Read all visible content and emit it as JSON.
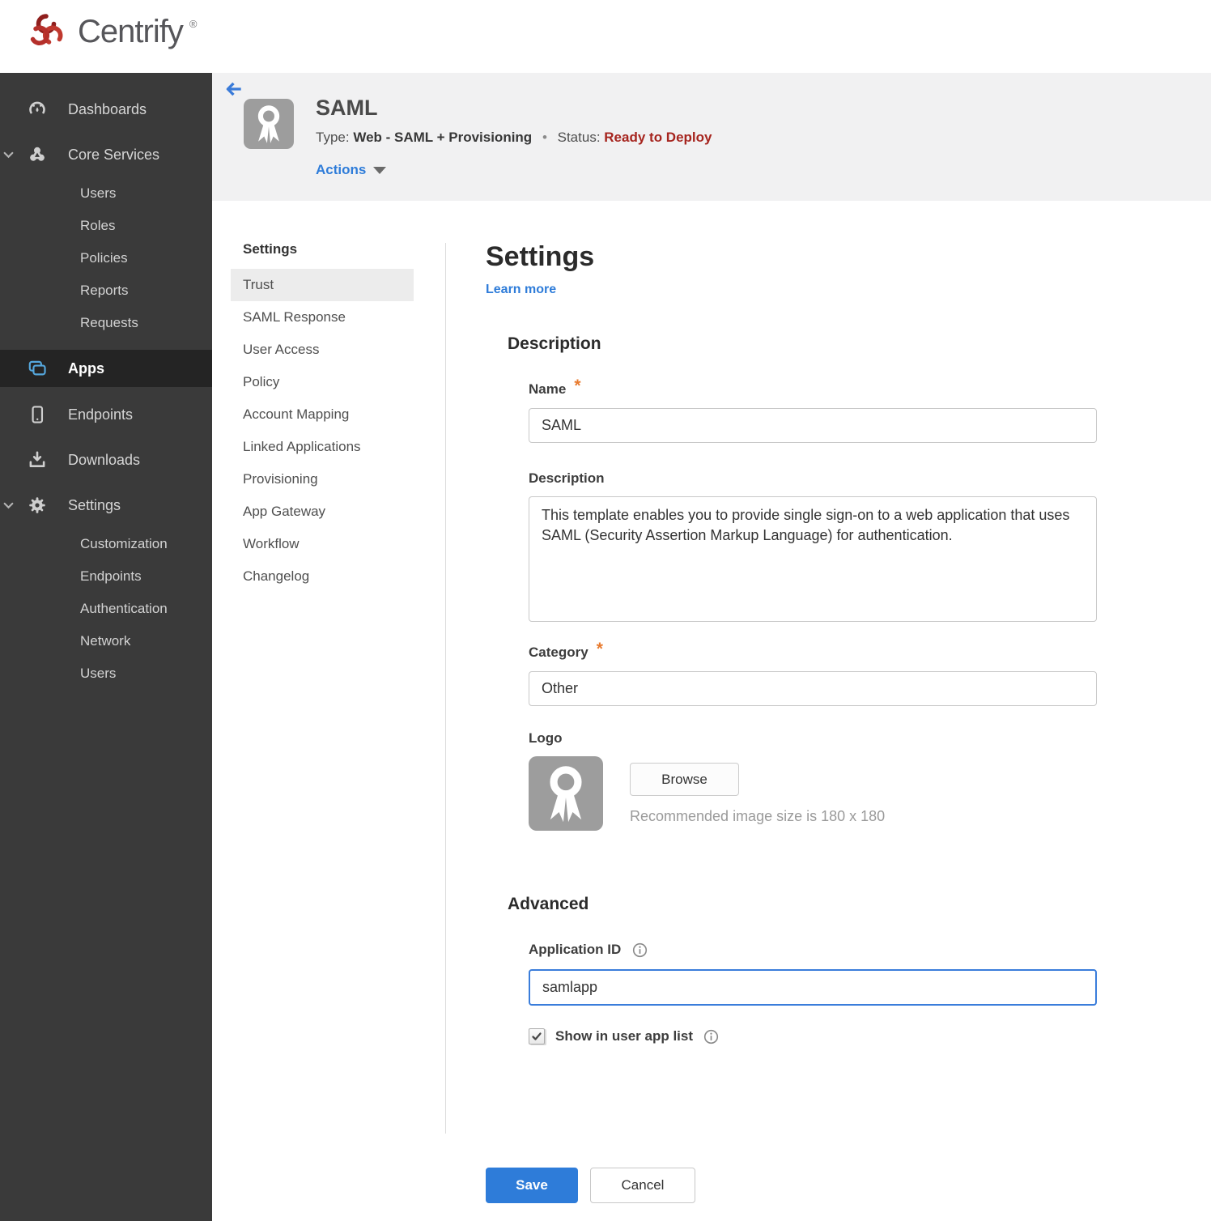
{
  "brand": {
    "name": "Centrify",
    "reg_mark": "®",
    "logo_color": "#b5302b"
  },
  "sidebar": {
    "items": [
      {
        "label": "Dashboards",
        "icon": "gauge-icon"
      },
      {
        "label": "Core Services",
        "icon": "core-services-icon",
        "expanded": true,
        "children": [
          "Users",
          "Roles",
          "Policies",
          "Reports",
          "Requests"
        ]
      },
      {
        "label": "Apps",
        "icon": "apps-icon",
        "active": true
      },
      {
        "label": "Endpoints",
        "icon": "device-icon"
      },
      {
        "label": "Downloads",
        "icon": "download-icon"
      },
      {
        "label": "Settings",
        "icon": "gear-icon",
        "expanded": true,
        "children": [
          "Customization",
          "Endpoints",
          "Authentication",
          "Network",
          "Users"
        ]
      }
    ]
  },
  "app_header": {
    "title": "SAML",
    "type_label": "Type:",
    "type_value": "Web - SAML + Provisioning",
    "separator": "•",
    "status_label": "Status:",
    "status_value": "Ready to Deploy",
    "status_color": "#a6251f",
    "actions_label": "Actions"
  },
  "subnav": {
    "header": "Settings",
    "active_item": "Trust",
    "items": [
      "Trust",
      "SAML Response",
      "User Access",
      "Policy",
      "Account Mapping",
      "Linked Applications",
      "Provisioning",
      "App Gateway",
      "Workflow",
      "Changelog"
    ]
  },
  "main": {
    "title": "Settings",
    "learn_more_label": "Learn more",
    "required_marker": "*",
    "sections": {
      "description": "Description",
      "advanced": "Advanced"
    },
    "fields": {
      "name_label": "Name",
      "name_value": "SAML",
      "description_label": "Description",
      "description_value": "This template enables you to provide single sign-on to a web application that uses SAML (Security Assertion Markup Language) for authentication.",
      "category_label": "Category",
      "category_value": "Other",
      "logo_label": "Logo",
      "browse_label": "Browse",
      "logo_hint": "Recommended image size is 180 x 180",
      "application_id_label": "Application ID",
      "application_id_value": "samlapp",
      "show_in_user_app_list_label": "Show in user app list",
      "show_in_user_app_list_checked": true
    },
    "buttons": {
      "save": "Save",
      "cancel": "Cancel"
    }
  },
  "colors": {
    "accent_blue": "#2e7cd9",
    "status_red": "#a6251f",
    "required_orange": "#e87a2e",
    "sidebar_bg": "#3a3a3a",
    "sidebar_active_bg": "#242424",
    "apps_icon_blue": "#55a7dd",
    "header_band": "#f1f1f2"
  }
}
